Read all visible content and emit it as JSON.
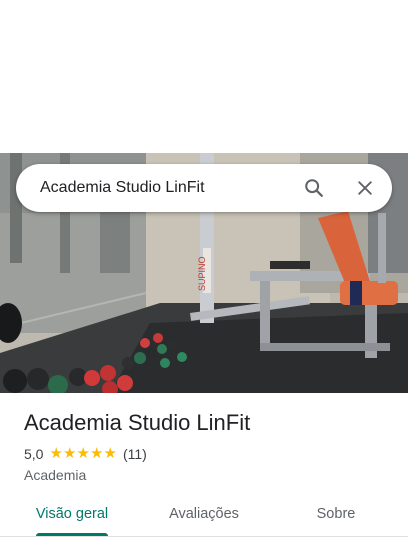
{
  "search": {
    "query": "Academia Studio LinFit",
    "search_icon": "search-icon",
    "close_icon": "close-icon"
  },
  "photo": {
    "description_icon": "gym-photo",
    "brand_text": "SUPINO"
  },
  "place": {
    "title": "Academia Studio LinFit",
    "rating_value": "5,0",
    "stars": 5,
    "review_count": "(11)",
    "category": "Academia"
  },
  "tabs": [
    {
      "label": "Visão geral",
      "active": true
    },
    {
      "label": "Avaliações",
      "active": false
    },
    {
      "label": "Sobre",
      "active": false
    }
  ],
  "colors": {
    "accent": "#00796b",
    "star": "#fbbc04",
    "text_primary": "#202124",
    "text_secondary": "#5f6368"
  }
}
